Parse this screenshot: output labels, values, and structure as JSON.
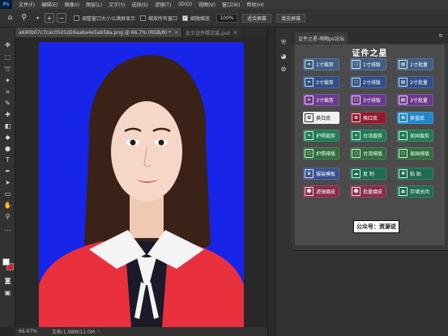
{
  "menubar": {
    "logo": "Ps",
    "items": [
      "文件(F)",
      "编辑(E)",
      "图像(I)",
      "图层(L)",
      "文字(Y)",
      "选择(S)",
      "滤镜(T)",
      "3D(D)",
      "视图(V)",
      "窗口(W)",
      "帮助(H)"
    ]
  },
  "options": {
    "resize_windows_label": "调整窗口大小以满屏显示",
    "resize_windows_checked": false,
    "zoom_all_label": "缩放所有窗口",
    "zoom_all_checked": false,
    "scrubby_label": "细微缩放",
    "scrubby_checked": true,
    "zoom_value": "100%",
    "fit_screen_label": "适合屏幕",
    "fill_screen_label": "填充屏幕"
  },
  "tabs": {
    "active": "a690b07c7cac0501d26aa6a4e5ab58a.png @ 66.7% (RGB/8) *",
    "inactive": "女士证件照正装.psd"
  },
  "status": {
    "zoom": "66.67%",
    "doc": "文档:1.98M/11.0M"
  },
  "panel": {
    "tab_label": "证件之星-萌陶ps论坛",
    "title": "证件之星",
    "buttons": [
      {
        "label": "1寸裁剪",
        "icon": "crop-icon",
        "glyph": "⌗",
        "color": "#3f5e86"
      },
      {
        "label": "1寸排版",
        "icon": "layout-icon",
        "glyph": "⬡",
        "color": "#3f5e86"
      },
      {
        "label": "1寸批量",
        "icon": "batch-icon",
        "glyph": "▤",
        "color": "#3f5e86"
      },
      {
        "label": "2寸裁剪",
        "icon": "crop-icon",
        "glyph": "⌗",
        "color": "#2f4f86"
      },
      {
        "label": "2寸排版",
        "icon": "layout-icon",
        "glyph": "⬡",
        "color": "#2f4f86"
      },
      {
        "label": "2寸批量",
        "icon": "batch-icon",
        "glyph": "▤",
        "color": "#2f4f86"
      },
      {
        "label": "3寸裁剪",
        "icon": "crop-icon",
        "glyph": "⌗",
        "color": "#6c3a8c"
      },
      {
        "label": "3寸排版",
        "icon": "layout-icon",
        "glyph": "⬡",
        "color": "#6c3a8c"
      },
      {
        "label": "3寸批量",
        "icon": "batch-icon",
        "glyph": "▤",
        "color": "#6c3a8c"
      },
      {
        "label": "换白底",
        "icon": "white-background-icon",
        "glyph": "✿",
        "color": "#f2f2f2"
      },
      {
        "label": "换红底",
        "icon": "red-background-icon",
        "glyph": "✿",
        "color": "#8e1b2e"
      },
      {
        "label": "换蓝底",
        "icon": "blue-background-icon",
        "glyph": "✿",
        "color": "#1f86c9"
      },
      {
        "label": "护照裁剪",
        "icon": "crop-icon",
        "glyph": "⌗",
        "color": "#1f7a55"
      },
      {
        "label": "台湾裁剪",
        "icon": "crop-icon",
        "glyph": "⌗",
        "color": "#1f7a55"
      },
      {
        "label": "美国裁剪",
        "icon": "crop-icon",
        "glyph": "⌗",
        "color": "#1f7a55"
      },
      {
        "label": "护照排版",
        "icon": "layout-icon",
        "glyph": "⬡",
        "color": "#2f6e3c"
      },
      {
        "label": "台湾排版",
        "icon": "layout-icon",
        "glyph": "⬡",
        "color": "#2f6e3c"
      },
      {
        "label": "美国排版",
        "icon": "layout-icon",
        "glyph": "⬡",
        "color": "#2f6e3c"
      },
      {
        "label": "服装模板",
        "icon": "clothing-template-icon",
        "glyph": "♛",
        "color": "#3a4f8f"
      },
      {
        "label": "复 制",
        "icon": "copy-icon",
        "glyph": "☁",
        "color": "#1d6b52"
      },
      {
        "label": "粘 贴",
        "icon": "paste-icon",
        "glyph": "✚",
        "color": "#1d6b52"
      },
      {
        "label": "滤镜磨皮",
        "icon": "filter-smooth-icon",
        "glyph": "☻",
        "color": "#8a2a4a"
      },
      {
        "label": "批量磨皮",
        "icon": "batch-smooth-icon",
        "glyph": "☻",
        "color": "#8a2a4a"
      },
      {
        "label": "存储关闭",
        "icon": "save-close-icon",
        "glyph": "⏏",
        "color": "#1d6b52"
      }
    ],
    "public_account": "公众号：资源说"
  }
}
